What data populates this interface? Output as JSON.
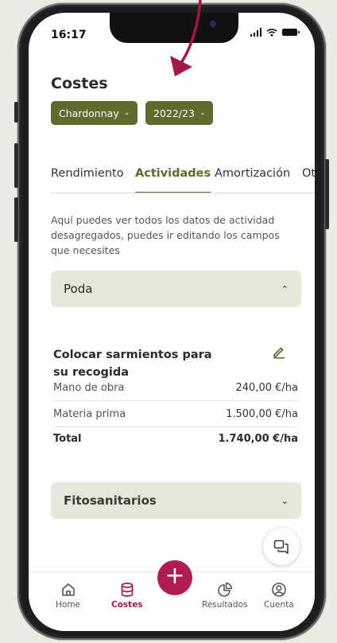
{
  "status_bar": {
    "time": "16:17"
  },
  "page": {
    "title": "Costes"
  },
  "filters": {
    "variety": "Chardonnay",
    "season": "2022/23"
  },
  "tabs": [
    {
      "label": "Rendimiento"
    },
    {
      "label": "Actividades"
    },
    {
      "label": "Amortización"
    },
    {
      "label": "Otr"
    }
  ],
  "info_text": "Aquí puedes ver todos los datos de actividad desagregados, puedes ir editando los campos que necesites",
  "sections": [
    {
      "label": "Poda",
      "expanded": true,
      "activity": {
        "title": "Colocar sarmientos para su recogida",
        "rows": [
          {
            "label": "Mano de obra",
            "value": "240,00 €/ha"
          },
          {
            "label": "Materia prima",
            "value": "1.500,00 €/ha"
          }
        ],
        "total": {
          "label": "Total",
          "value": "1.740,00 €/ha"
        }
      }
    },
    {
      "label": "Fitosanitarios",
      "expanded": false
    }
  ],
  "bottom_nav": [
    {
      "label": "Home",
      "icon": "home-icon"
    },
    {
      "label": "Costes",
      "icon": "database-icon",
      "active": true
    },
    {
      "label": "Resultados",
      "icon": "pie-chart-icon"
    },
    {
      "label": "Cuenta",
      "icon": "user-circle-icon"
    }
  ],
  "colors": {
    "primary": "#5e6a2e",
    "accent": "#b11c53",
    "section_bg": "#e6e8d9"
  }
}
